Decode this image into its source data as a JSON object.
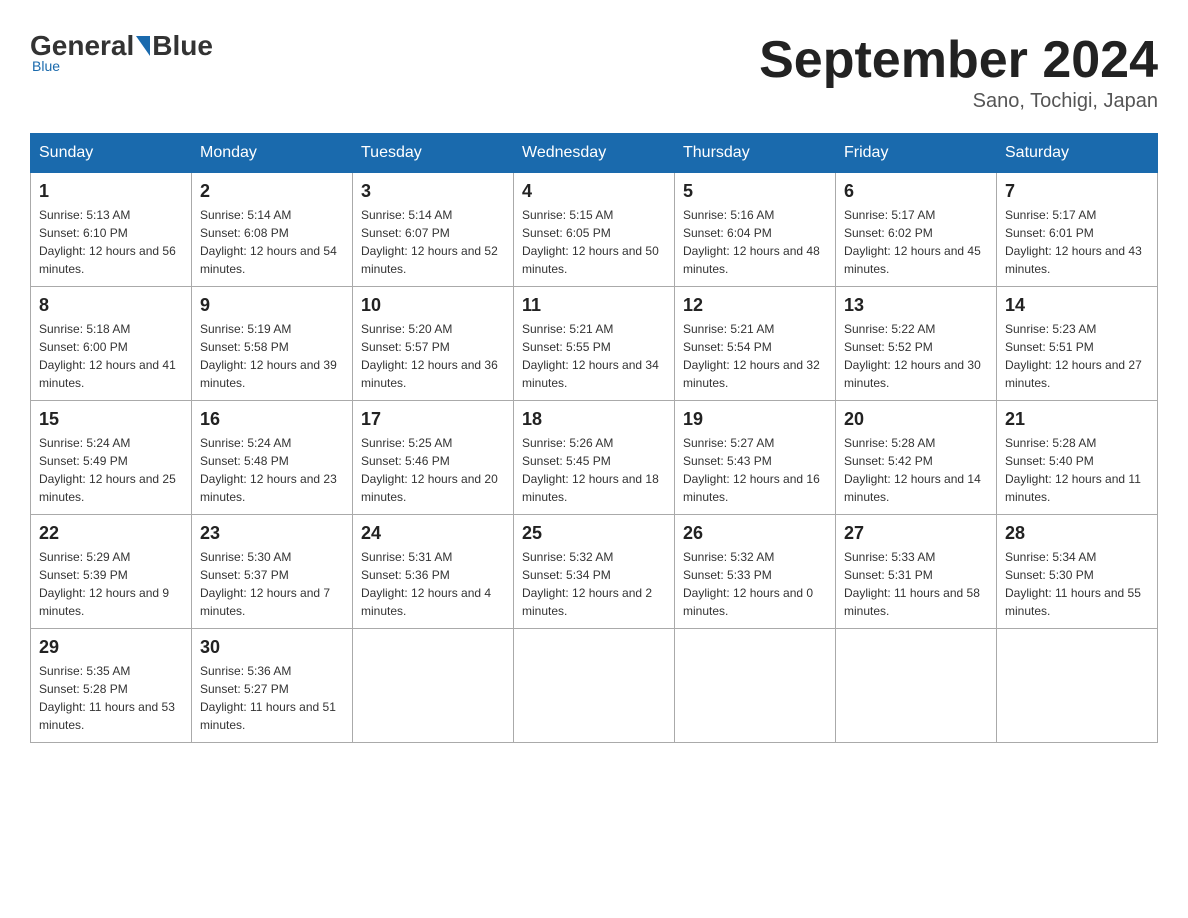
{
  "logo": {
    "general": "General",
    "blue": "Blue",
    "subtitle": "Blue"
  },
  "header": {
    "title": "September 2024",
    "location": "Sano, Tochigi, Japan"
  },
  "weekdays": [
    "Sunday",
    "Monday",
    "Tuesday",
    "Wednesday",
    "Thursday",
    "Friday",
    "Saturday"
  ],
  "weeks": [
    [
      {
        "day": "1",
        "sunrise": "5:13 AM",
        "sunset": "6:10 PM",
        "daylight": "12 hours and 56 minutes."
      },
      {
        "day": "2",
        "sunrise": "5:14 AM",
        "sunset": "6:08 PM",
        "daylight": "12 hours and 54 minutes."
      },
      {
        "day": "3",
        "sunrise": "5:14 AM",
        "sunset": "6:07 PM",
        "daylight": "12 hours and 52 minutes."
      },
      {
        "day": "4",
        "sunrise": "5:15 AM",
        "sunset": "6:05 PM",
        "daylight": "12 hours and 50 minutes."
      },
      {
        "day": "5",
        "sunrise": "5:16 AM",
        "sunset": "6:04 PM",
        "daylight": "12 hours and 48 minutes."
      },
      {
        "day": "6",
        "sunrise": "5:17 AM",
        "sunset": "6:02 PM",
        "daylight": "12 hours and 45 minutes."
      },
      {
        "day": "7",
        "sunrise": "5:17 AM",
        "sunset": "6:01 PM",
        "daylight": "12 hours and 43 minutes."
      }
    ],
    [
      {
        "day": "8",
        "sunrise": "5:18 AM",
        "sunset": "6:00 PM",
        "daylight": "12 hours and 41 minutes."
      },
      {
        "day": "9",
        "sunrise": "5:19 AM",
        "sunset": "5:58 PM",
        "daylight": "12 hours and 39 minutes."
      },
      {
        "day": "10",
        "sunrise": "5:20 AM",
        "sunset": "5:57 PM",
        "daylight": "12 hours and 36 minutes."
      },
      {
        "day": "11",
        "sunrise": "5:21 AM",
        "sunset": "5:55 PM",
        "daylight": "12 hours and 34 minutes."
      },
      {
        "day": "12",
        "sunrise": "5:21 AM",
        "sunset": "5:54 PM",
        "daylight": "12 hours and 32 minutes."
      },
      {
        "day": "13",
        "sunrise": "5:22 AM",
        "sunset": "5:52 PM",
        "daylight": "12 hours and 30 minutes."
      },
      {
        "day": "14",
        "sunrise": "5:23 AM",
        "sunset": "5:51 PM",
        "daylight": "12 hours and 27 minutes."
      }
    ],
    [
      {
        "day": "15",
        "sunrise": "5:24 AM",
        "sunset": "5:49 PM",
        "daylight": "12 hours and 25 minutes."
      },
      {
        "day": "16",
        "sunrise": "5:24 AM",
        "sunset": "5:48 PM",
        "daylight": "12 hours and 23 minutes."
      },
      {
        "day": "17",
        "sunrise": "5:25 AM",
        "sunset": "5:46 PM",
        "daylight": "12 hours and 20 minutes."
      },
      {
        "day": "18",
        "sunrise": "5:26 AM",
        "sunset": "5:45 PM",
        "daylight": "12 hours and 18 minutes."
      },
      {
        "day": "19",
        "sunrise": "5:27 AM",
        "sunset": "5:43 PM",
        "daylight": "12 hours and 16 minutes."
      },
      {
        "day": "20",
        "sunrise": "5:28 AM",
        "sunset": "5:42 PM",
        "daylight": "12 hours and 14 minutes."
      },
      {
        "day": "21",
        "sunrise": "5:28 AM",
        "sunset": "5:40 PM",
        "daylight": "12 hours and 11 minutes."
      }
    ],
    [
      {
        "day": "22",
        "sunrise": "5:29 AM",
        "sunset": "5:39 PM",
        "daylight": "12 hours and 9 minutes."
      },
      {
        "day": "23",
        "sunrise": "5:30 AM",
        "sunset": "5:37 PM",
        "daylight": "12 hours and 7 minutes."
      },
      {
        "day": "24",
        "sunrise": "5:31 AM",
        "sunset": "5:36 PM",
        "daylight": "12 hours and 4 minutes."
      },
      {
        "day": "25",
        "sunrise": "5:32 AM",
        "sunset": "5:34 PM",
        "daylight": "12 hours and 2 minutes."
      },
      {
        "day": "26",
        "sunrise": "5:32 AM",
        "sunset": "5:33 PM",
        "daylight": "12 hours and 0 minutes."
      },
      {
        "day": "27",
        "sunrise": "5:33 AM",
        "sunset": "5:31 PM",
        "daylight": "11 hours and 58 minutes."
      },
      {
        "day": "28",
        "sunrise": "5:34 AM",
        "sunset": "5:30 PM",
        "daylight": "11 hours and 55 minutes."
      }
    ],
    [
      {
        "day": "29",
        "sunrise": "5:35 AM",
        "sunset": "5:28 PM",
        "daylight": "11 hours and 53 minutes."
      },
      {
        "day": "30",
        "sunrise": "5:36 AM",
        "sunset": "5:27 PM",
        "daylight": "11 hours and 51 minutes."
      },
      {
        "day": "",
        "sunrise": "",
        "sunset": "",
        "daylight": ""
      },
      {
        "day": "",
        "sunrise": "",
        "sunset": "",
        "daylight": ""
      },
      {
        "day": "",
        "sunrise": "",
        "sunset": "",
        "daylight": ""
      },
      {
        "day": "",
        "sunrise": "",
        "sunset": "",
        "daylight": ""
      },
      {
        "day": "",
        "sunrise": "",
        "sunset": "",
        "daylight": ""
      }
    ]
  ]
}
